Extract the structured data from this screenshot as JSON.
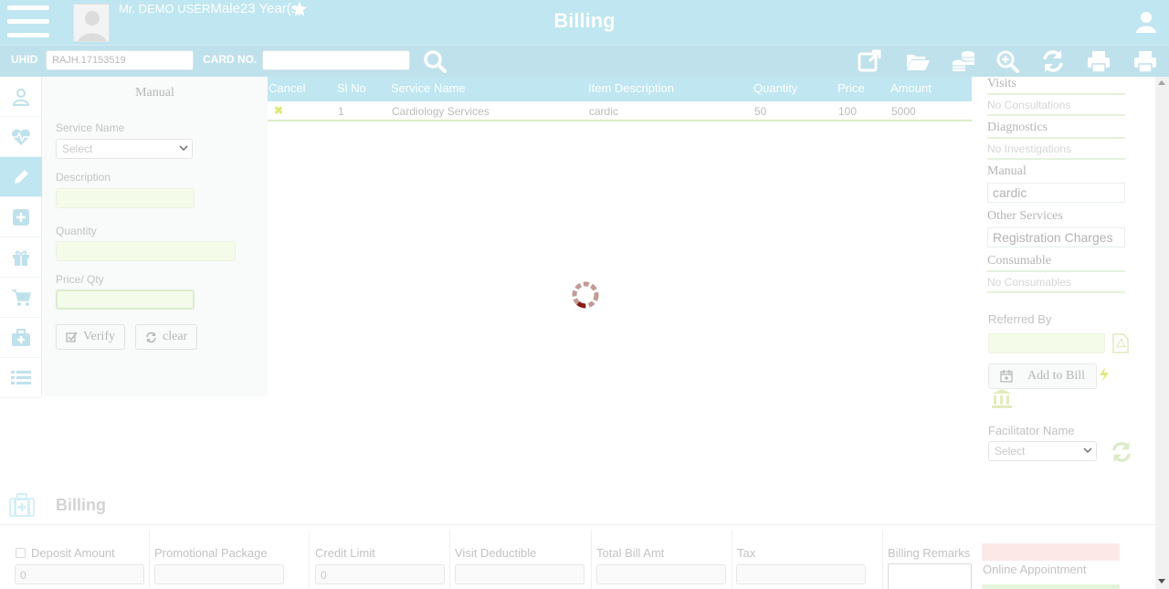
{
  "header": {
    "patient_name": "Mr. DEMO USER",
    "patient_gender": "Male",
    "patient_age": "23 Year(s)",
    "title": "Billing"
  },
  "toolbar": {
    "uhid_label": "UHID",
    "uhid_value": "RAJH.17153519",
    "card_label": "CARD NO.",
    "card_value": ""
  },
  "rail": {
    "icons": [
      "patient-icon",
      "heartbeat-icon",
      "pencil-icon",
      "plus-square-icon",
      "gift-icon",
      "cart-icon",
      "medical-kit-icon",
      "list-icon"
    ],
    "active_index": 2
  },
  "manual": {
    "title": "Manual",
    "service_name_label": "Service Name",
    "service_select": "Select",
    "description_label": "Description",
    "quantity_label": "Quantity",
    "price_label": "Price/ Qty",
    "verify_label": "Verify",
    "clear_label": "clear"
  },
  "table": {
    "headers": [
      "Cancel",
      "Sl No",
      "Service Name",
      "Item Description",
      "Quantity",
      "Price",
      "Amount"
    ],
    "rows": [
      {
        "cancel": "✖",
        "sl": "1",
        "service": "Cardiology Services",
        "desc": "cardic",
        "qty": "50",
        "price": "100",
        "amount": "5000"
      }
    ]
  },
  "right": {
    "visits_title": "Visits",
    "visits_empty": "No Consultations",
    "diagnostics_title": "Diagnostics",
    "diagnostics_empty": "No Investigations",
    "manual_title": "Manual",
    "manual_item": "cardic",
    "other_title": "Other Services",
    "other_item": "Registration Charges",
    "consumable_title": "Consumable",
    "consumable_empty": "No Consumables",
    "referred_label": "Referred By",
    "add_to_bill_label": "Add to Bill",
    "facilitator_label": "Facilitator Name",
    "facilitator_select": "Select"
  },
  "footer": {
    "title": "Billing",
    "deposit_label": "Deposit Amount",
    "deposit_value": "0",
    "promo_label": "Promotional Package",
    "credit_label": "Credit Limit",
    "credit_value": "0",
    "visit_label": "Visit Deductible",
    "total_label": "Total Bill Amt",
    "tax_label": "Tax",
    "remarks_label": "Billing Remarks",
    "online_label": "Online Appointment"
  },
  "colors": {
    "accent": "#bfe6f1",
    "muted_text": "#c3c3c3",
    "spinner": "#a0322f"
  }
}
